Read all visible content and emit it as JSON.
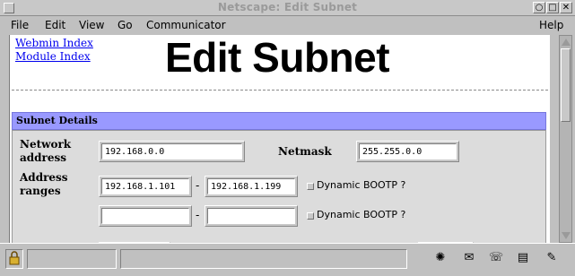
{
  "window": {
    "title": "Netscape: Edit Subnet"
  },
  "window_controls": {
    "minimize": "○",
    "maximize": "□",
    "close": "✕"
  },
  "menu": {
    "file": "File",
    "edit": "Edit",
    "view": "View",
    "go": "Go",
    "communicator": "Communicator",
    "help": "Help"
  },
  "links": {
    "webmin_index": "Webmin Index",
    "module_index": "Module Index"
  },
  "page": {
    "title": "Edit Subnet"
  },
  "panel": {
    "heading": "Subnet Details",
    "heading_color": "#9999ff"
  },
  "form": {
    "network_address": {
      "label_line1": "Network",
      "label_line2": "address",
      "value": "192.168.0.0"
    },
    "netmask": {
      "label": "Netmask",
      "value": "255.255.0.0"
    },
    "address_ranges": {
      "label_line1": "Address",
      "label_line2": "ranges",
      "range1": {
        "from": "192.168.1.101",
        "to": "192.168.1.199",
        "dynamic_bootp": "Dynamic BOOTP ?"
      },
      "range2": {
        "from": "",
        "to": "",
        "dynamic_bootp": "Dynamic BOOTP ?"
      },
      "separator": "-"
    }
  },
  "icons": {
    "lock": "lock-icon",
    "status_icons": [
      "network-icon",
      "mail-icon",
      "chat-icon",
      "compose-icon",
      "edit-icon"
    ]
  }
}
